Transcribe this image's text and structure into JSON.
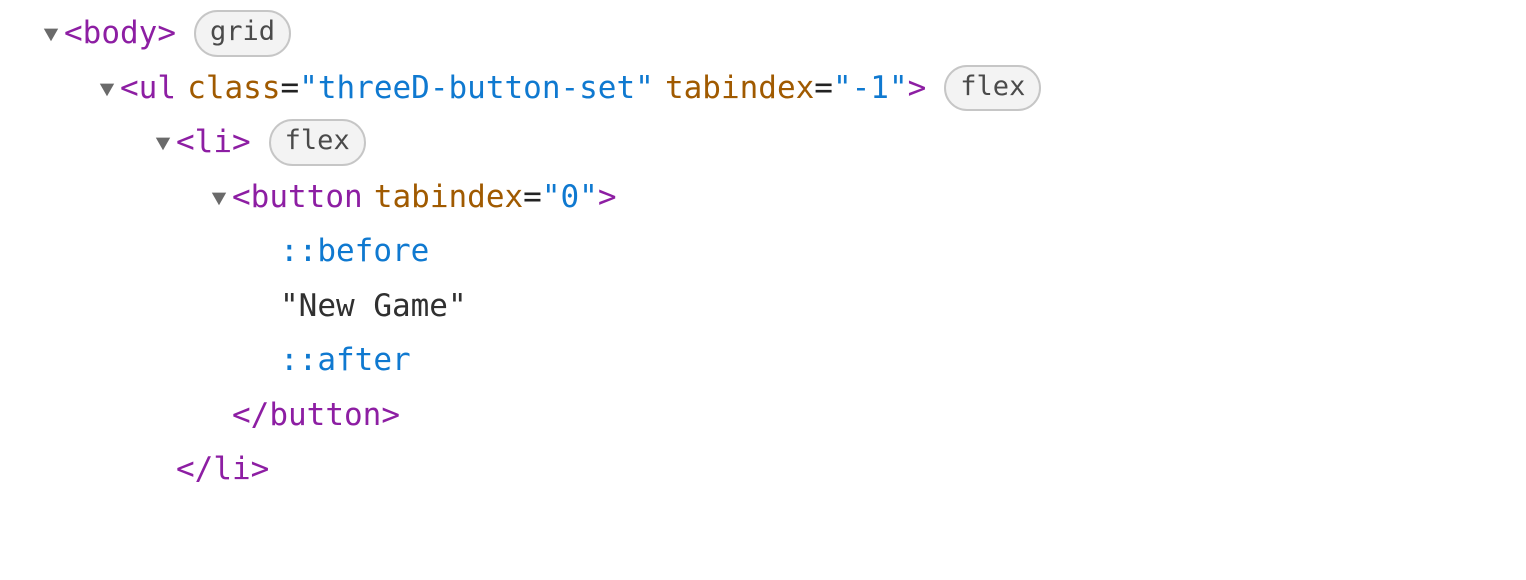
{
  "rows": [
    {
      "indent": 0,
      "chevron": true,
      "parts": [
        {
          "t": "punct",
          "v": "<"
        },
        {
          "t": "tag",
          "v": "body"
        },
        {
          "t": "punct",
          "v": ">"
        }
      ],
      "badge": "grid"
    },
    {
      "indent": 1,
      "chevron": true,
      "parts": [
        {
          "t": "punct",
          "v": "<"
        },
        {
          "t": "tag",
          "v": "ul"
        },
        {
          "t": "sp"
        },
        {
          "t": "attr",
          "v": "class"
        },
        {
          "t": "eq",
          "v": "="
        },
        {
          "t": "val",
          "v": "\"threeD-button-set\""
        },
        {
          "t": "sp"
        },
        {
          "t": "attr",
          "v": "tabindex"
        },
        {
          "t": "eq",
          "v": "="
        },
        {
          "t": "val",
          "v": "\"-1\""
        },
        {
          "t": "punct",
          "v": ">"
        }
      ],
      "badge": "flex"
    },
    {
      "indent": 2,
      "chevron": true,
      "parts": [
        {
          "t": "punct",
          "v": "<"
        },
        {
          "t": "tag",
          "v": "li"
        },
        {
          "t": "punct",
          "v": ">"
        }
      ],
      "badge": "flex"
    },
    {
      "indent": 3,
      "chevron": true,
      "parts": [
        {
          "t": "punct",
          "v": "<"
        },
        {
          "t": "tag",
          "v": "button"
        },
        {
          "t": "sp"
        },
        {
          "t": "attr",
          "v": "tabindex"
        },
        {
          "t": "eq",
          "v": "="
        },
        {
          "t": "val",
          "v": "\"0\""
        },
        {
          "t": "punct",
          "v": ">"
        }
      ]
    },
    {
      "indent": 4,
      "chevron": false,
      "parts": [
        {
          "t": "pseudo",
          "v": "::before"
        }
      ]
    },
    {
      "indent": 4,
      "chevron": false,
      "parts": [
        {
          "t": "text",
          "v": "\"New Game\""
        }
      ]
    },
    {
      "indent": 4,
      "chevron": false,
      "parts": [
        {
          "t": "pseudo",
          "v": "::after"
        }
      ]
    },
    {
      "indent": 3,
      "chevron": false,
      "parts": [
        {
          "t": "punct",
          "v": "</"
        },
        {
          "t": "tag",
          "v": "button"
        },
        {
          "t": "punct",
          "v": ">"
        }
      ]
    },
    {
      "indent": 2,
      "chevron": false,
      "parts": [
        {
          "t": "punct",
          "v": "</"
        },
        {
          "t": "tag",
          "v": "li"
        },
        {
          "t": "punct",
          "v": ">"
        }
      ]
    }
  ]
}
